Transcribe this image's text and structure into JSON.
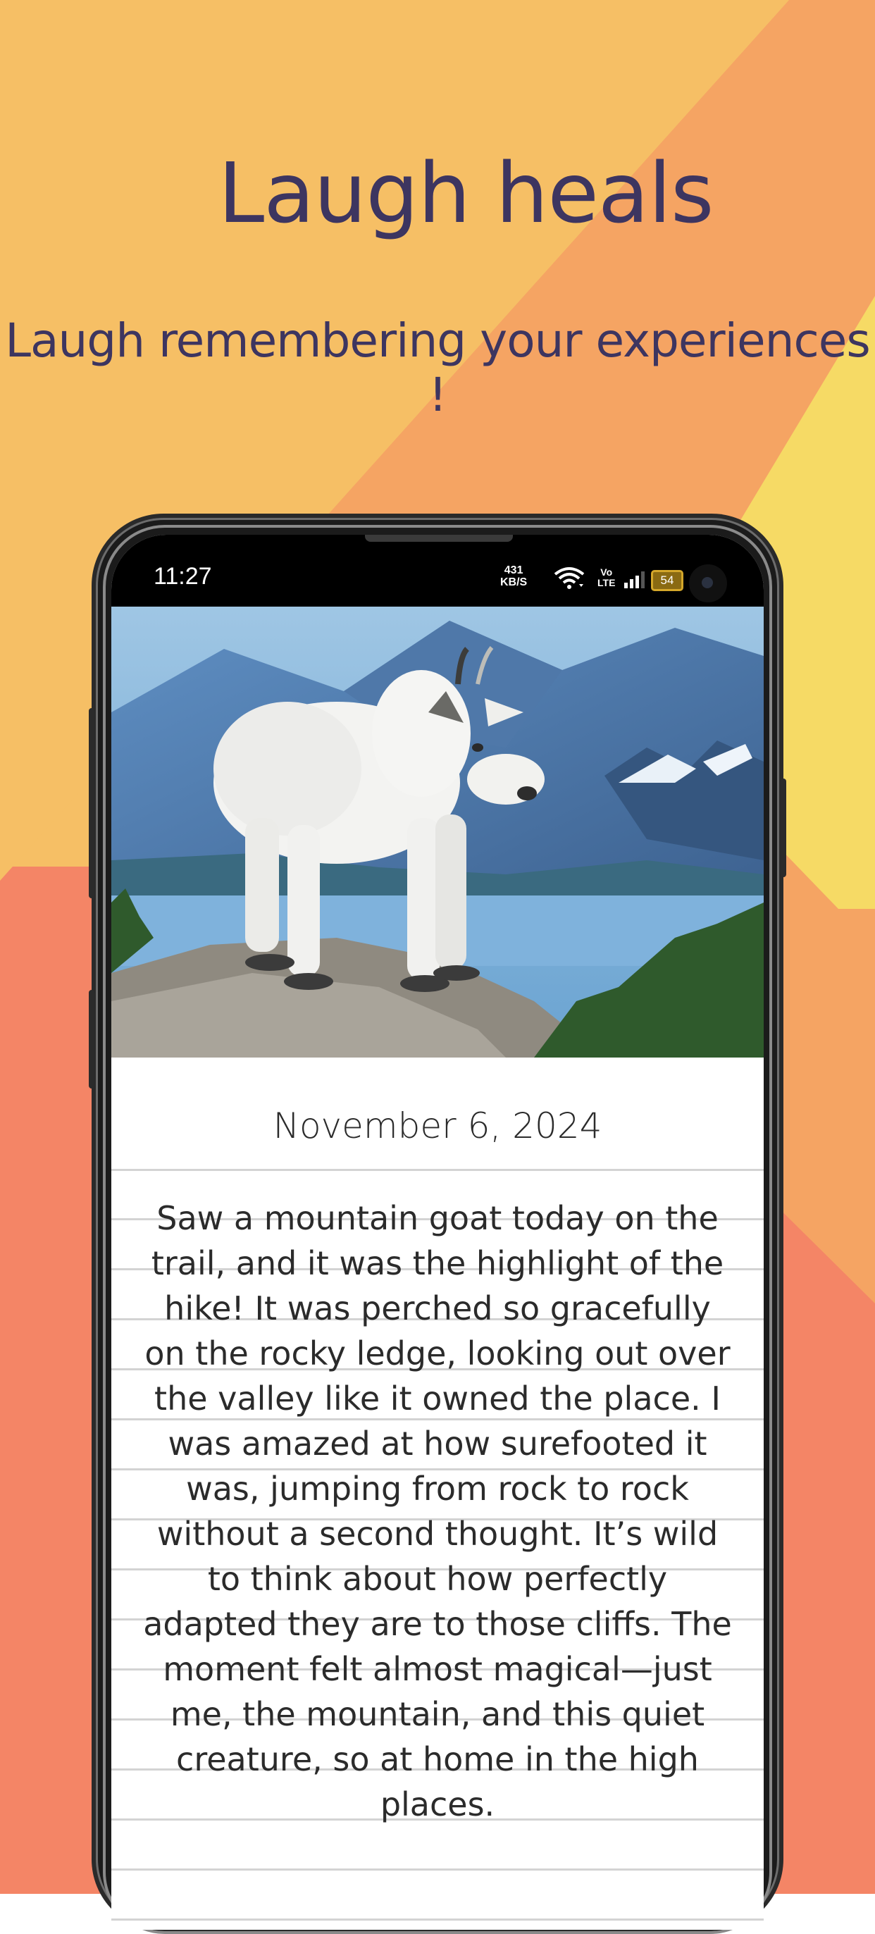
{
  "headline": {
    "title": "Laugh heals",
    "subtitle": "Laugh remembering your experiences !"
  },
  "colors": {
    "bg_orange_light": "#f6bf65",
    "bg_peach": "#f5a463",
    "bg_coral": "#f48566",
    "bg_yellow": "#f6da65",
    "text_navy": "#3d3560"
  },
  "status_bar": {
    "time": "11:27",
    "net_speed_value": "431",
    "net_speed_unit": "KB/S",
    "volte_top": "Vo",
    "volte_bottom": "LTE",
    "battery": "54"
  },
  "entry": {
    "image": "mountain-goat-photo",
    "date": "November 6, 2024",
    "text": "Saw a mountain goat today on the trail, and it was the highlight of the hike! It was perched so gracefully on the rocky ledge, looking out over the valley like it owned the place. I was amazed at how surefooted it was, jumping from rock to rock without a second thought. It’s wild to think about how perfectly adapted they are to those cliffs. The moment felt almost magical—just me, the mountain, and this quiet creature, so at home in the high places."
  }
}
